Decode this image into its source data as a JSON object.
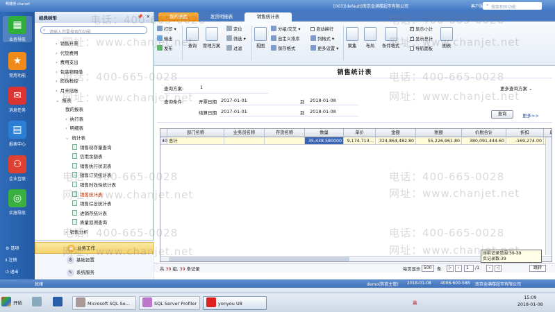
{
  "window": {
    "logo": "畅捷通 chanjet",
    "title": "[003](default)南京金满楼超市有限公司",
    "service_label": "客户服务",
    "search_placeholder": "搜索相关功能"
  },
  "left_bar": {
    "items": [
      {
        "label": "业务导航",
        "icon": "grid-icon",
        "color": "#2fae3a",
        "active": true
      },
      {
        "label": "常用功能",
        "icon": "star-icon",
        "color": "#f08a18",
        "active": false
      },
      {
        "label": "消息任务",
        "icon": "message-icon",
        "color": "#d33",
        "active": false
      },
      {
        "label": "报表中心",
        "icon": "chart-icon",
        "color": "#2a7fd5",
        "active": false
      },
      {
        "label": "企业互联",
        "icon": "people-icon",
        "color": "#e0402f",
        "active": false
      },
      {
        "label": "实施导航",
        "icon": "compass-icon",
        "color": "#3ab040",
        "active": false
      }
    ],
    "footer": [
      {
        "label": "选项",
        "icon": "gear-icon"
      },
      {
        "label": "注销",
        "icon": "logout-icon"
      },
      {
        "label": "退出",
        "icon": "exit-icon"
      }
    ]
  },
  "nav_panel": {
    "title": "经典树形",
    "pin": "📌",
    "close": "✕",
    "search_placeholder": "请输入您要搜索的功能",
    "tree": [
      {
        "label": "销售开票",
        "level": 0,
        "arrow": "›",
        "folder": false,
        "highlight": false
      },
      {
        "label": "代垫费用",
        "level": 0,
        "arrow": "›",
        "folder": false,
        "highlight": false
      },
      {
        "label": "费用支出",
        "level": 0,
        "arrow": "›",
        "folder": false,
        "highlight": false
      },
      {
        "label": "包装物租借",
        "level": 0,
        "arrow": "›",
        "folder": false,
        "highlight": false
      },
      {
        "label": "防伪税控",
        "level": 0,
        "arrow": "›",
        "folder": false,
        "highlight": false
      },
      {
        "label": "月末结账",
        "level": 0,
        "arrow": "›",
        "folder": false,
        "highlight": false
      },
      {
        "label": "报表",
        "level": 0,
        "arrow": "⌄",
        "folder": false,
        "highlight": false
      },
      {
        "label": "我的报表",
        "level": 1,
        "arrow": "",
        "folder": false,
        "highlight": false
      },
      {
        "label": "执行表",
        "level": 1,
        "arrow": "›",
        "folder": false,
        "highlight": false
      },
      {
        "label": "明细表",
        "level": 1,
        "arrow": "›",
        "folder": false,
        "highlight": false
      },
      {
        "label": "统计表",
        "level": 1,
        "arrow": "⌄",
        "folder": false,
        "highlight": false
      },
      {
        "label": "销售现存量查询",
        "level": 2,
        "arrow": "",
        "folder": true,
        "highlight": false
      },
      {
        "label": "信用余额表",
        "level": 2,
        "arrow": "",
        "folder": true,
        "highlight": false
      },
      {
        "label": "销售执行状况表",
        "level": 2,
        "arrow": "",
        "folder": true,
        "highlight": false
      },
      {
        "label": "销售订货统计表",
        "level": 2,
        "arrow": "",
        "folder": true,
        "highlight": false
      },
      {
        "label": "销售时效性统计表",
        "level": 2,
        "arrow": "",
        "folder": true,
        "highlight": false
      },
      {
        "label": "销售统计表",
        "level": 2,
        "arrow": "",
        "folder": true,
        "highlight": true
      },
      {
        "label": "销售综合统计表",
        "level": 2,
        "arrow": "",
        "folder": true,
        "highlight": false
      },
      {
        "label": "进销存统计表",
        "level": 2,
        "arrow": "",
        "folder": true,
        "highlight": false
      },
      {
        "label": "质量追溯查询",
        "level": 2,
        "arrow": "",
        "folder": true,
        "highlight": false
      },
      {
        "label": "销售分析",
        "level": 1,
        "arrow": "›",
        "folder": false,
        "highlight": false
      }
    ],
    "bottom": [
      {
        "label": "业务工作",
        "selected": true
      },
      {
        "label": "基础设置",
        "selected": false
      },
      {
        "label": "系统服务",
        "selected": false
      }
    ]
  },
  "tabs": [
    {
      "label": "我的桌面",
      "style": "orange"
    },
    {
      "label": "发货明细表",
      "style": "plain"
    },
    {
      "label": "销售统计表",
      "style": "active"
    }
  ],
  "toolbar": {
    "print": "打印",
    "output": "输出",
    "publish": "发布",
    "query": "查询",
    "manage_plan": "管理方案",
    "locate": "定位",
    "filter": "筛选",
    "filter2": "过滤",
    "view": "视图",
    "group_cross": "分组/交叉",
    "custom_sort": "自定义排序",
    "save_format": "保存格式",
    "auto_wrap": "自动换行",
    "column_format": "列格式",
    "more_settings": "更多设置",
    "gather": "聚集",
    "layout": "布局",
    "condition_format": "条件格式",
    "show_subtotal": "显示小计",
    "show_total": "显示总计",
    "guide_panel": "导航面板",
    "chart": "图表",
    "checks": {
      "auto_wrap": false,
      "show_subtotal": true,
      "show_total": true,
      "guide_panel": false
    }
  },
  "report": {
    "title": "销售统计表",
    "plan_label": "查询方案:",
    "plan_value": "1",
    "more_plans": "更多查询方案",
    "cond_label": "查询条件:",
    "open_date_label": "开票日期",
    "open_date_from": "2017-01-01",
    "to1": "到",
    "open_date_to": "2018-01-08",
    "settle_date_label": "结算日期",
    "settle_date_from": "2017-01-01",
    "to2": "到",
    "settle_date_to": "2018-01-08",
    "query_button": "查询",
    "more_link": "更多>>"
  },
  "grid": {
    "columns": [
      "部门名称",
      "业务员名称",
      "存货名称",
      "数量",
      "单价",
      "金额",
      "税额",
      "价税合计",
      "折扣",
      "成"
    ],
    "rows": [
      {
        "rownum": "40",
        "cells": [
          "总计",
          "",
          "",
          "35,438.580000",
          "9,174.713…",
          "324,864,482.80",
          "55,226,961.80",
          "380,091,444.60",
          "-169,274.00",
          "289,39"
        ]
      }
    ]
  },
  "footer": {
    "prefix": "共",
    "groups": "39",
    "groups_suffix": "组,",
    "records": "39",
    "records_suffix": "条记录",
    "per_page_label": "每页显示",
    "per_page": "500",
    "per_page_unit": "条",
    "page": "1",
    "page_total": "/1",
    "jump": "跳转",
    "rec_range": "当前记录范围:39-39",
    "rec_total": "页记录数:39"
  },
  "status_bar": {
    "ready": "就绪",
    "user": "demo(陈蓝主管)",
    "date": "2018-01-08",
    "phone": "4006-600-588",
    "company": "南京金满楼超市有限公司"
  },
  "taskbar": {
    "start": "开始",
    "items": [
      {
        "label": "Microsoft SQL Se...",
        "active": false
      },
      {
        "label": "SQL Server Profiler",
        "active": false
      },
      {
        "label": "yonyou U8",
        "active": true
      }
    ],
    "ime": "英",
    "time": "15:09",
    "date": "2018-01-08"
  },
  "watermarks": [
    "电话：400-665-0028",
    "网址：www.chanjet.net"
  ]
}
